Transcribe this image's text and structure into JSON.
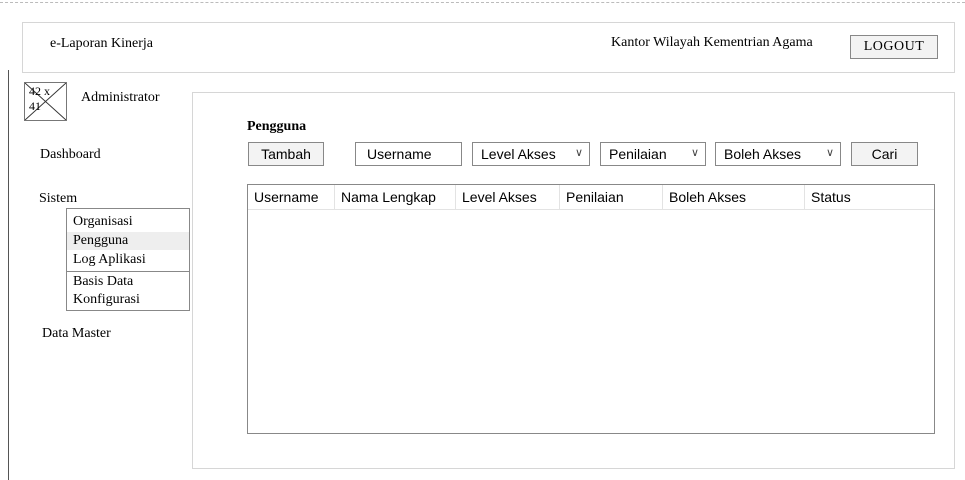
{
  "header": {
    "app_title": "e-Laporan Kinerja",
    "org_name": "Kantor Wilayah Kementrian Agama",
    "logout_label": "LOGOUT"
  },
  "user": {
    "avatar_placeholder": "42 x 41",
    "role": "Administrator"
  },
  "sidebar": {
    "dashboard": "Dashboard",
    "sistem": "Sistem",
    "sistem_items": [
      "Organisasi",
      "Pengguna",
      "Log Aplikasi",
      "Basis Data",
      "Konfigurasi"
    ],
    "active_item": "Pengguna",
    "data_master": "Data Master"
  },
  "main": {
    "title": "Pengguna",
    "add_button": "Tambah",
    "username_value": "Username",
    "filters": {
      "level_akses": "Level Akses",
      "penilaian": "Penilaian",
      "boleh_akses": "Boleh Akses"
    },
    "search_button": "Cari",
    "table": {
      "columns": [
        "Username",
        "Nama Lengkap",
        "Level Akses",
        "Penilaian",
        "Boleh Akses",
        "Status"
      ],
      "rows": []
    }
  }
}
